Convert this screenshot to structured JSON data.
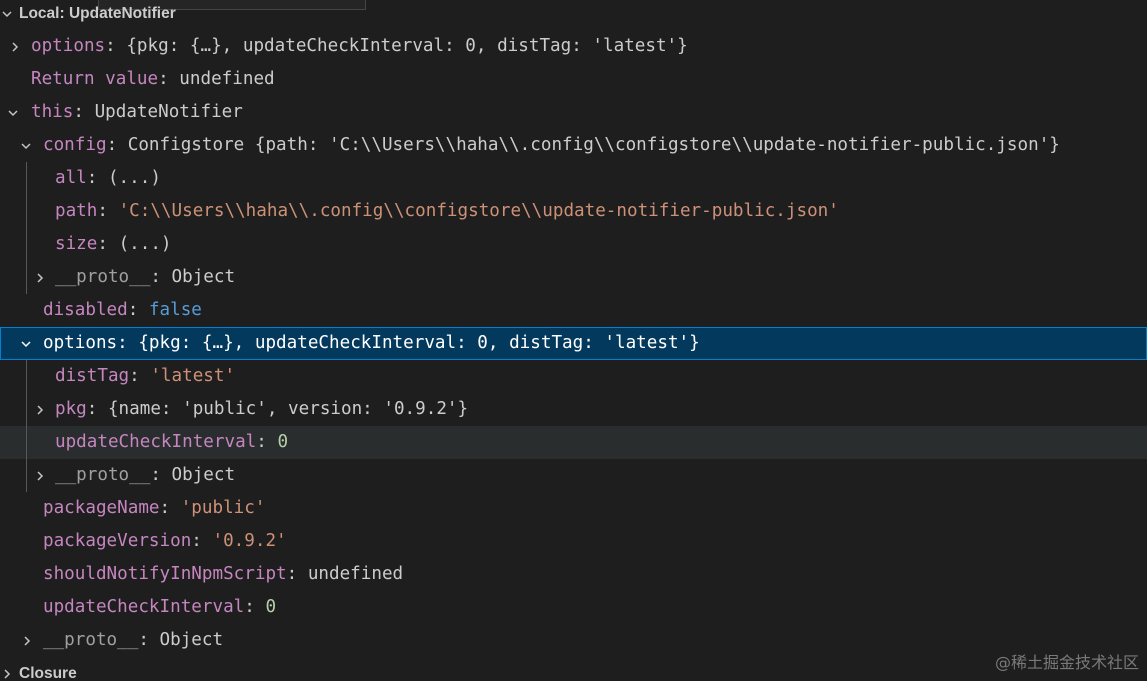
{
  "scopes": {
    "local_label": "Local: UpdateNotifier",
    "closure_label": "Closure"
  },
  "rows": {
    "options_top": {
      "name": "options",
      "value": "{pkg: {…}, updateCheckInterval: 0, distTag: 'latest'}"
    },
    "return_value": {
      "name": "Return value",
      "value": "undefined"
    },
    "this": {
      "name": "this",
      "value": "UpdateNotifier"
    },
    "config": {
      "name": "config",
      "value": "Configstore {path: 'C:\\\\Users\\\\haha\\\\.config\\\\configstore\\\\update-notifier-public.json'}"
    },
    "config_all": {
      "name": "all",
      "value": "(...)"
    },
    "config_path": {
      "name": "path",
      "value": "'C:\\\\Users\\\\haha\\\\.config\\\\configstore\\\\update-notifier-public.json'"
    },
    "config_size": {
      "name": "size",
      "value": "(...)"
    },
    "config_proto": {
      "name": "__proto__",
      "value": "Object"
    },
    "disabled": {
      "name": "disabled",
      "value": "false"
    },
    "options": {
      "name": "options",
      "value": "{pkg: {…}, updateCheckInterval: 0, distTag: 'latest'}"
    },
    "options_disttag": {
      "name": "distTag",
      "value": "'latest'"
    },
    "options_pkg": {
      "name": "pkg",
      "value": "{name: 'public', version: '0.9.2'}"
    },
    "options_interval": {
      "name": "updateCheckInterval",
      "value": "0"
    },
    "options_proto": {
      "name": "__proto__",
      "value": "Object"
    },
    "package_name": {
      "name": "packageName",
      "value": "'public'"
    },
    "package_version": {
      "name": "packageVersion",
      "value": "'0.9.2'"
    },
    "should_notify": {
      "name": "shouldNotifyInNpmScript",
      "value": "undefined"
    },
    "update_interval": {
      "name": "updateCheckInterval",
      "value": "0"
    },
    "this_proto": {
      "name": "__proto__",
      "value": "Object"
    }
  },
  "separator": ": ",
  "watermark": "@稀土掘金技术社区",
  "colors": {
    "background": "#1e1e1e",
    "property_name": "#c586c0",
    "string": "#ce9178",
    "number": "#b5cea8",
    "boolean": "#569cd6",
    "selection": "#04395e"
  }
}
